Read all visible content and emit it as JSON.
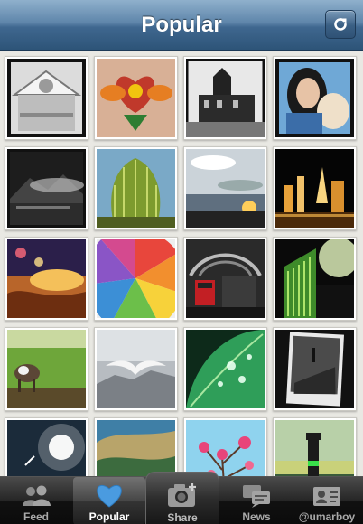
{
  "header": {
    "title": "Popular",
    "refresh_icon": "refresh-icon"
  },
  "photos": [
    {
      "id": 1,
      "alt": "building facade"
    },
    {
      "id": 2,
      "alt": "tattoo"
    },
    {
      "id": 3,
      "alt": "house"
    },
    {
      "id": 4,
      "alt": "portrait"
    },
    {
      "id": 5,
      "alt": "mountain lake"
    },
    {
      "id": 6,
      "alt": "tree"
    },
    {
      "id": 7,
      "alt": "sunset clouds"
    },
    {
      "id": 8,
      "alt": "city night"
    },
    {
      "id": 9,
      "alt": "bokeh sky"
    },
    {
      "id": 10,
      "alt": "umbrella"
    },
    {
      "id": 11,
      "alt": "station bus"
    },
    {
      "id": 12,
      "alt": "green building"
    },
    {
      "id": 13,
      "alt": "cow field"
    },
    {
      "id": 14,
      "alt": "seagull"
    },
    {
      "id": 15,
      "alt": "leaf drops"
    },
    {
      "id": 16,
      "alt": "street bw"
    },
    {
      "id": 17,
      "alt": "sun sky"
    },
    {
      "id": 18,
      "alt": "landscape"
    },
    {
      "id": 19,
      "alt": "pink blossom"
    },
    {
      "id": 20,
      "alt": "lighthouse"
    }
  ],
  "tabs": [
    {
      "label": "Feed",
      "icon": "people-icon"
    },
    {
      "label": "Popular",
      "icon": "heart-icon"
    },
    {
      "label": "Share",
      "icon": "camera-icon"
    },
    {
      "label": "News",
      "icon": "speech-bubbles-icon"
    },
    {
      "label": "@umarboy",
      "icon": "profile-card-icon"
    }
  ],
  "colors": {
    "nav": "#3f678f",
    "tabbar": "#111111",
    "heart": "#4a9be0"
  }
}
